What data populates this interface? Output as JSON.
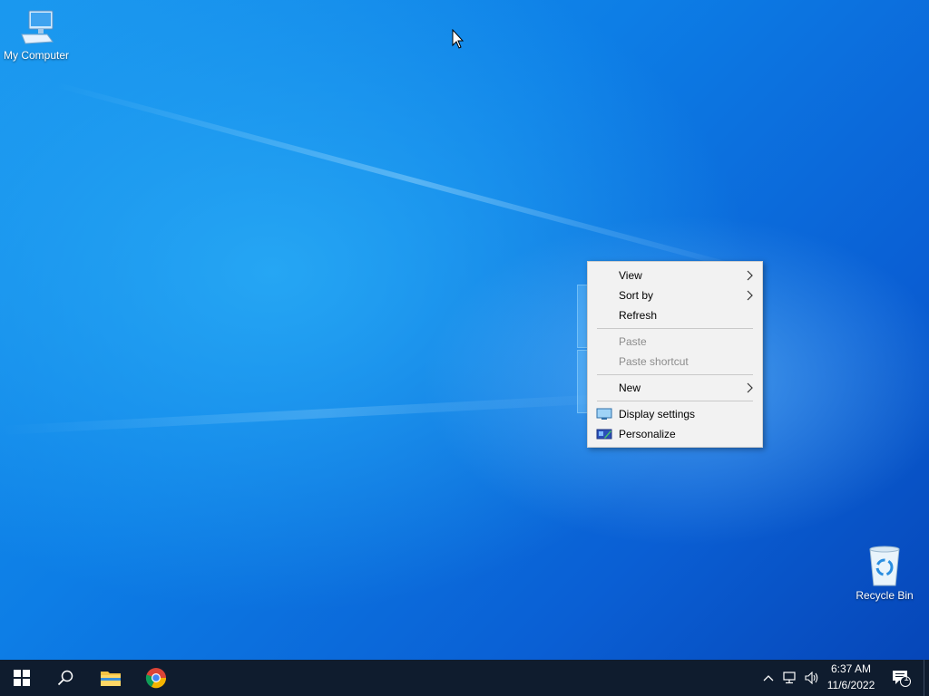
{
  "desktop": {
    "icons": [
      {
        "label": "My Computer"
      },
      {
        "label": "Recycle Bin"
      }
    ]
  },
  "context_menu": {
    "items": [
      {
        "label": "View",
        "submenu": true,
        "disabled": false
      },
      {
        "label": "Sort by",
        "submenu": true,
        "disabled": false
      },
      {
        "label": "Refresh",
        "submenu": false,
        "disabled": false
      },
      {
        "label": "Paste",
        "submenu": false,
        "disabled": true
      },
      {
        "label": "Paste shortcut",
        "submenu": false,
        "disabled": true
      },
      {
        "label": "New",
        "submenu": true,
        "disabled": false
      },
      {
        "label": "Display settings",
        "icon": "display-icon",
        "disabled": false
      },
      {
        "label": "Personalize",
        "icon": "personalize-icon",
        "disabled": false
      }
    ]
  },
  "taskbar": {
    "pinned": [
      {
        "icon": "windows-start-icon"
      },
      {
        "icon": "search-icon"
      },
      {
        "icon": "file-explorer-icon"
      },
      {
        "icon": "chrome-icon"
      }
    ],
    "tray": {
      "icons": [
        "chevron-up-icon",
        "network-icon",
        "volume-icon"
      ],
      "time": "6:37 AM",
      "date": "11/6/2022",
      "notification_count": "1"
    }
  },
  "colors": {
    "taskbar_bg": "#0f1c2e",
    "menu_bg": "#f2f2f2",
    "desktop_blue": "#0d7ee6"
  }
}
